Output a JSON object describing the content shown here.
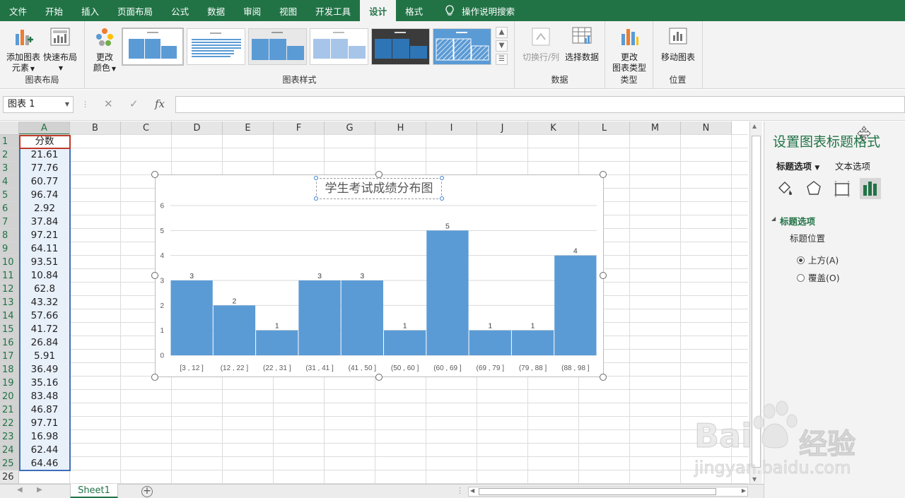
{
  "tabs": [
    "文件",
    "开始",
    "插入",
    "页面布局",
    "公式",
    "数据",
    "审阅",
    "视图",
    "开发工具",
    "设计",
    "格式"
  ],
  "active_tab": "设计",
  "search_label": "操作说明搜索",
  "ribbon": {
    "add_element": {
      "line1": "添加图表",
      "line2": "元素"
    },
    "quick_layout": "快速布局",
    "group_layout": "图表布局",
    "change_colors": {
      "line1": "更改",
      "line2": "颜色"
    },
    "group_styles": "图表样式",
    "switch_row_col": "切换行/列",
    "select_data": "选择数据",
    "group_data": "数据",
    "change_type": {
      "line1": "更改",
      "line2": "图表类型"
    },
    "group_type": "类型",
    "move_chart": "移动图表",
    "group_position": "位置"
  },
  "formula_bar": {
    "name_box": "图表 1",
    "formula": ""
  },
  "columns": [
    "A",
    "B",
    "C",
    "D",
    "E",
    "F",
    "G",
    "H",
    "I",
    "J",
    "K",
    "L",
    "M",
    "N"
  ],
  "rows": [
    "1",
    "2",
    "3",
    "4",
    "5",
    "6",
    "7",
    "8",
    "9",
    "10",
    "11",
    "12",
    "13",
    "14",
    "15",
    "16",
    "17",
    "18",
    "19",
    "20",
    "21",
    "22",
    "23",
    "24",
    "25",
    "26"
  ],
  "column_a_header": "分数",
  "column_a_values": [
    "21.61",
    "77.76",
    "60.77",
    "96.74",
    "2.92",
    "37.84",
    "97.21",
    "64.11",
    "93.51",
    "10.84",
    "62.8",
    "43.32",
    "57.66",
    "41.72",
    "26.84",
    "5.91",
    "36.49",
    "35.16",
    "83.48",
    "46.87",
    "97.71",
    "16.98",
    "62.44",
    "64.46"
  ],
  "chart_data": {
    "type": "bar",
    "title": "学生考试成绩分布图",
    "categories": [
      "[3 , 12 ]",
      "(12 , 22 ]",
      "(22 , 31 ]",
      "(31 , 41 ]",
      "(41 , 50 ]",
      "(50 , 60 ]",
      "(60 , 69 ]",
      "(69 , 79 ]",
      "(79 , 88 ]",
      "(88 , 98 ]"
    ],
    "values": [
      3,
      2,
      1,
      3,
      3,
      1,
      5,
      1,
      1,
      4
    ],
    "ylim": [
      0,
      6
    ],
    "yticks": [
      "0",
      "1",
      "2",
      "3",
      "4",
      "5",
      "6"
    ],
    "bar_color": "#5b9bd5",
    "grid": true,
    "data_labels": true
  },
  "pane": {
    "title": "设置图表标题格式",
    "tab_title_options": "标题选项",
    "tab_text_options": "文本选项",
    "section": "标题选项",
    "subsection": "标题位置",
    "option_above": "上方(A)",
    "option_overlay": "覆盖(O)",
    "selected": "上方(A)"
  },
  "sheet_tab": "Sheet1",
  "watermark": {
    "brand": "Bai",
    "brand2": "经验",
    "url": "jingyan.baidu.com"
  },
  "colors": {
    "accent": "#217346",
    "selection": "#3d6fba"
  }
}
